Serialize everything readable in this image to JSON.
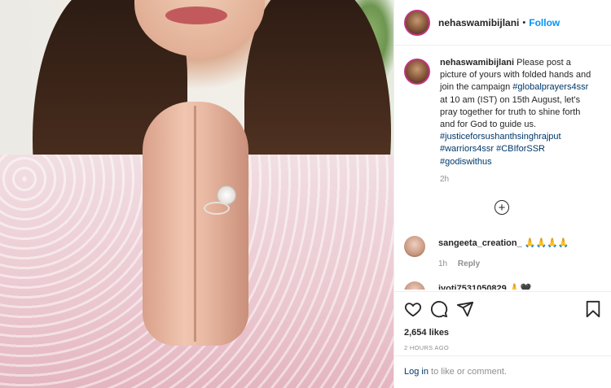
{
  "post": {
    "username": "nehaswamibijlani",
    "separator": "•",
    "follow_label": "Follow",
    "caption": {
      "username": "nehaswamibijlani",
      "text": "Please post a picture of yours with folded hands and join the campaign",
      "tag1": "#globalprayers4ssr",
      "text2": "at 10 am (IST) on 15th August, let's pray together for truth to shine forth and for God to guide us.",
      "tag2": "#justiceforsushanthsinghrajput",
      "tag3": "#warriors4ssr",
      "tag4": "#CBIforSSR",
      "tag5": "#godiswithus",
      "time": "2h"
    },
    "load_more_icon": "plus-circle-icon",
    "comments": [
      {
        "username": "sangeeta_creation_",
        "text": "🙏🙏🙏🙏",
        "time": "1h",
        "reply_label": "Reply"
      },
      {
        "username": "jyoti7531050829",
        "text": "🙏🖤"
      }
    ],
    "likes": "2,654 likes",
    "posted_ago": "2 HOURS AGO",
    "login": {
      "link": "Log in",
      "rest": "to like or comment."
    },
    "icons": [
      "heart-icon",
      "comment-icon",
      "share-icon",
      "bookmark-icon"
    ]
  }
}
